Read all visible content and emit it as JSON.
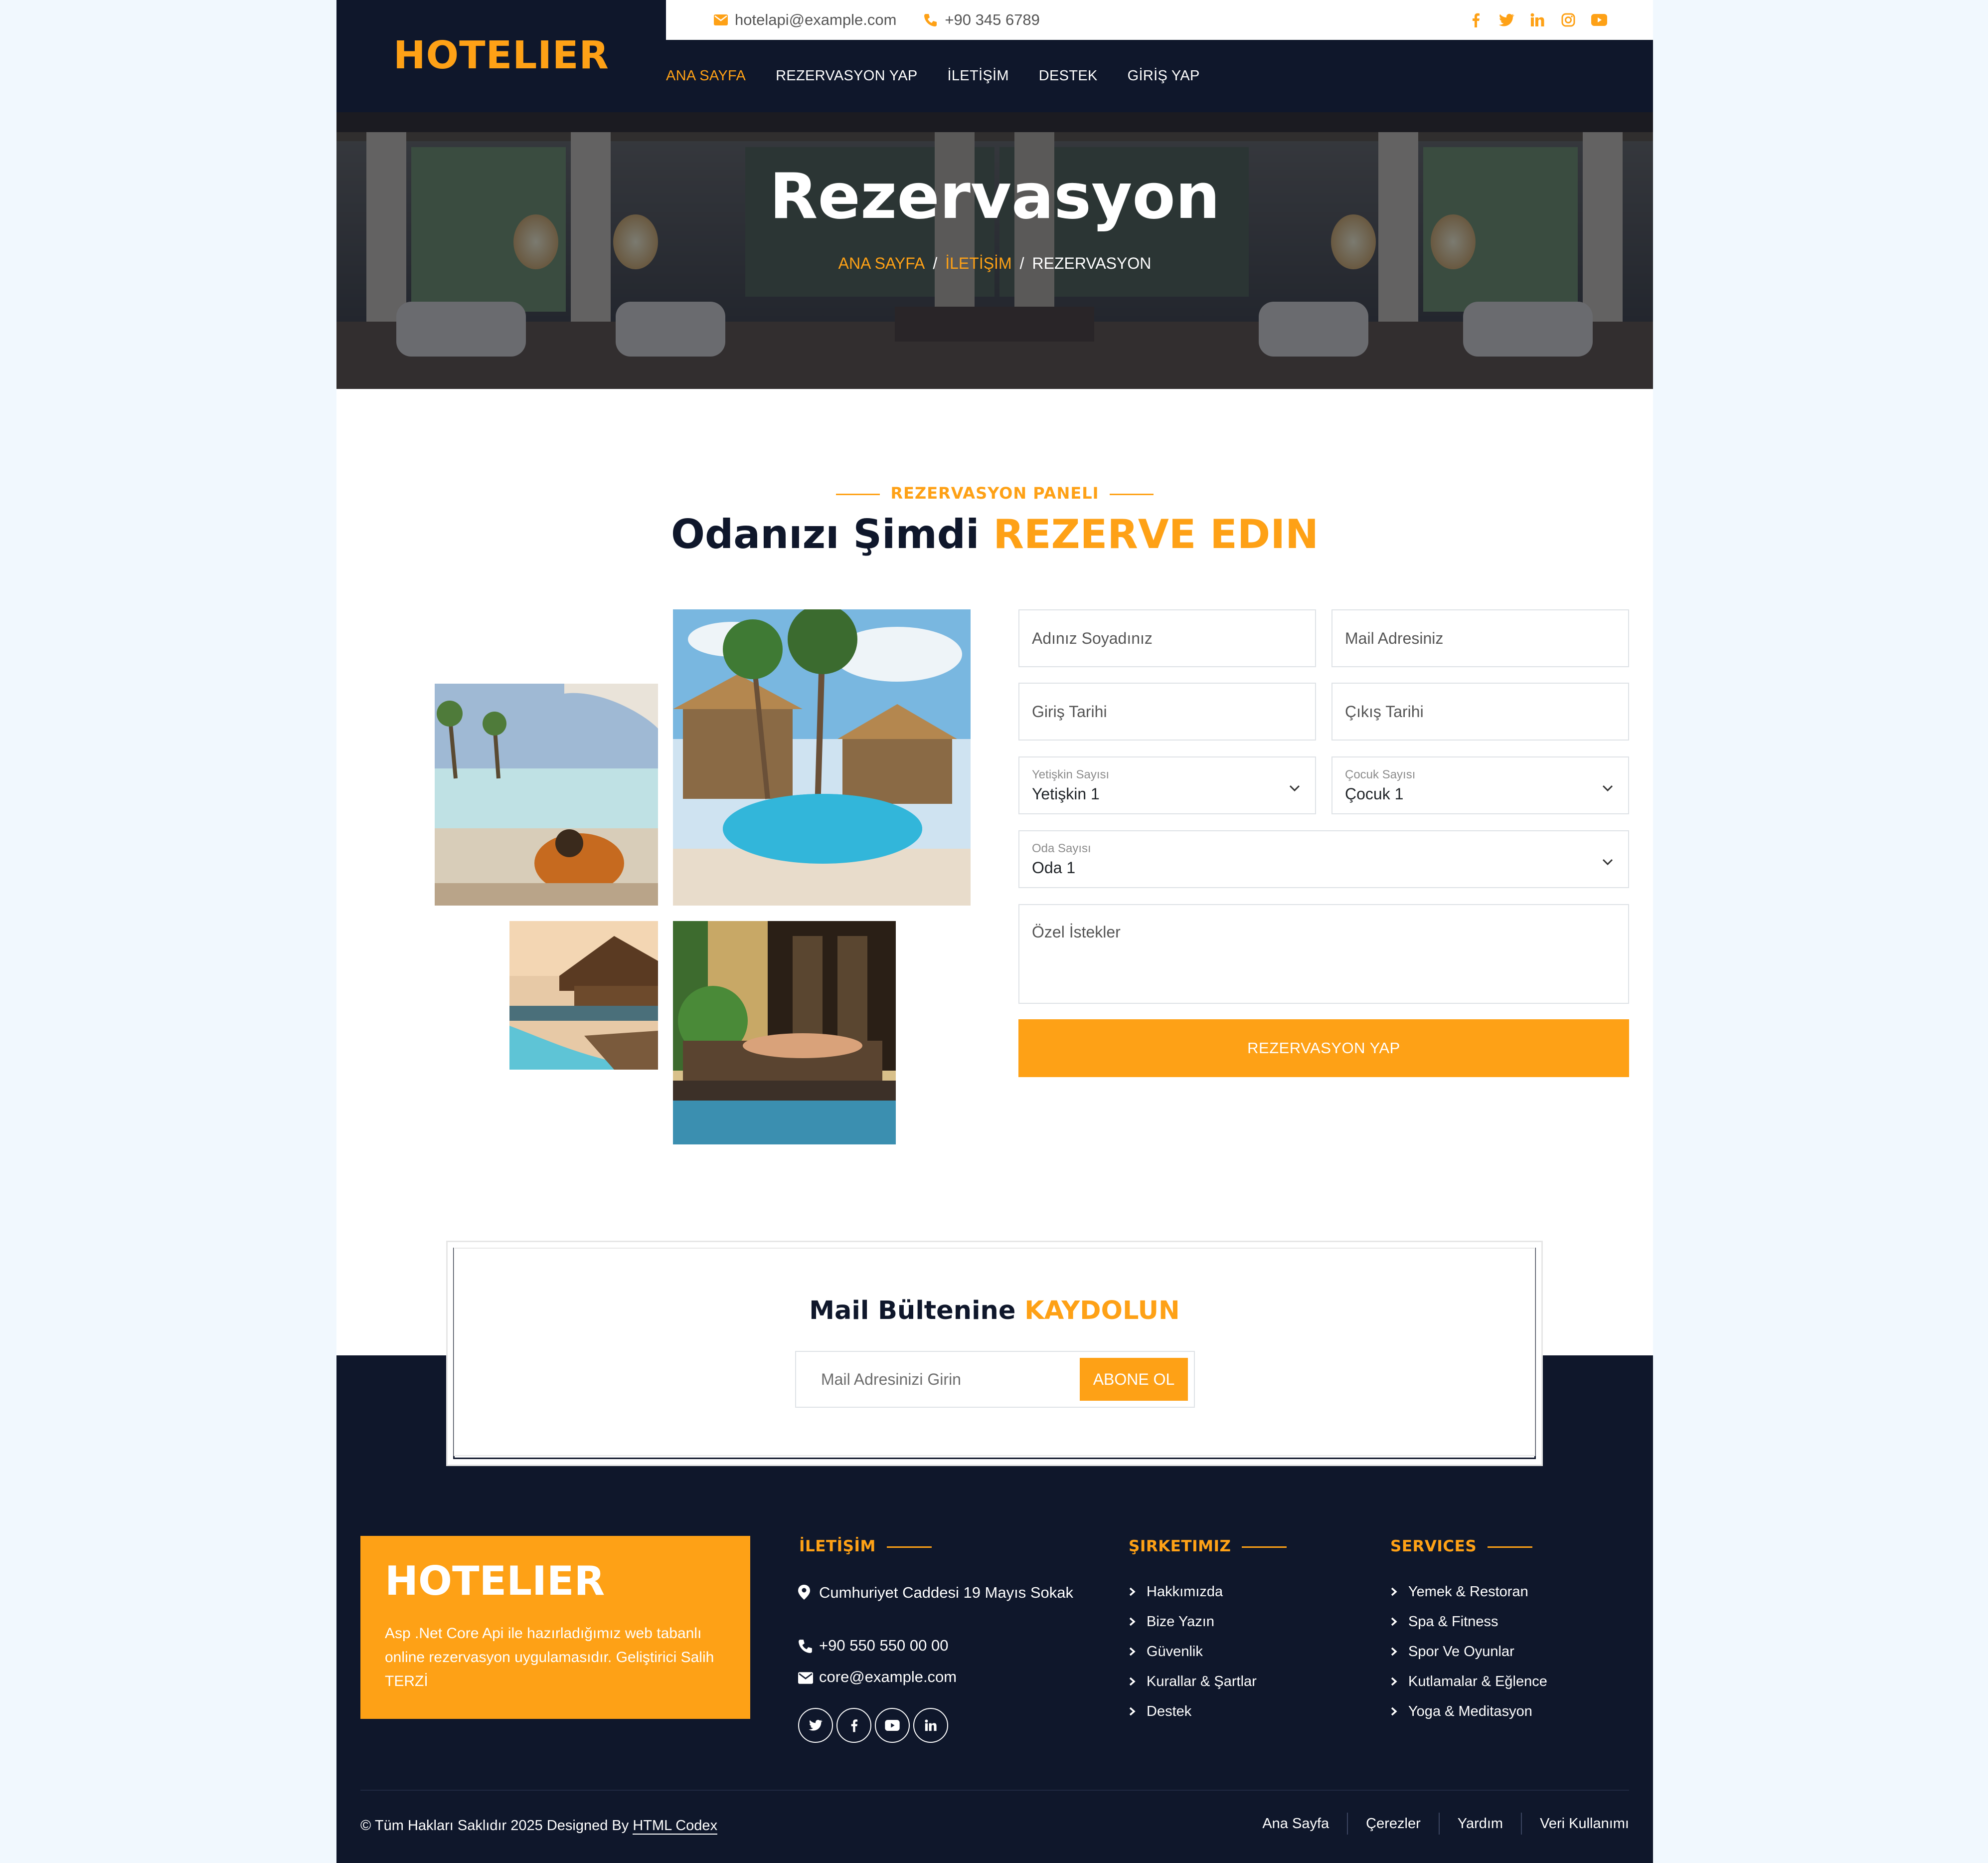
{
  "brand": {
    "name": "HOTELIER"
  },
  "topbar": {
    "email": "hotelapi@example.com",
    "phone": "+90 345 6789",
    "socials": [
      "facebook-icon",
      "twitter-icon",
      "linkedin-icon",
      "instagram-icon",
      "youtube-icon"
    ]
  },
  "nav": {
    "items": [
      {
        "label": "ANA SAYFA",
        "active": true
      },
      {
        "label": "REZERVASYON YAP"
      },
      {
        "label": "İLETİŞİM"
      },
      {
        "label": "DESTEK"
      },
      {
        "label": "GİRİŞ YAP"
      }
    ]
  },
  "hero": {
    "title": "Rezervasyon",
    "breadcrumb": [
      "ANA SAYFA",
      "İLETİŞİM",
      "REZERVASYON"
    ],
    "separator": "/"
  },
  "booking": {
    "subtitle": "REZERVASYON PANELI",
    "title_main": "Odanızı Şimdi",
    "title_accent": "REZERVE EDIN",
    "form": {
      "name_placeholder": "Adınız Soyadınız",
      "email_placeholder": "Mail Adresiniz",
      "checkin_placeholder": "Giriş Tarihi",
      "checkout_placeholder": "Çıkış Tarihi",
      "adults": {
        "label": "Yetişkin Sayısı",
        "value": "Yetişkin 1"
      },
      "children": {
        "label": "Çocuk Sayısı",
        "value": "Çocuk 1"
      },
      "rooms": {
        "label": "Oda Sayısı",
        "value": "Oda 1"
      },
      "requests_placeholder": "Özel İstekler",
      "submit_label": "REZERVASYON YAP"
    }
  },
  "newsletter": {
    "title_main": "Mail Bültenine",
    "title_accent": "KAYDOLUN",
    "placeholder": "Mail Adresinizi Girin",
    "button_label": "ABONE OL"
  },
  "footer": {
    "brand_name": "HOTELIER",
    "brand_description": "Asp .Net Core Api ile hazırladığımız web tabanlı online rezervasyon uygulamasıdır. Geliştirici Salih TERZİ",
    "contact": {
      "title": "İLETİŞİM",
      "address": "Cumhuriyet Caddesi 19 Mayıs Sokak",
      "phone": "+90 550 550 00 00",
      "email": "core@example.com",
      "socials": [
        "twitter-icon",
        "facebook-icon",
        "youtube-icon",
        "linkedin-icon"
      ]
    },
    "company": {
      "title": "ŞIRKETIMIZ",
      "items": [
        "Hakkımızda",
        "Bize Yazın",
        "Güvenlik",
        "Kurallar & Şartlar",
        "Destek"
      ]
    },
    "services": {
      "title": "SERVICES",
      "items": [
        "Yemek & Restoran",
        "Spa & Fitness",
        "Spor Ve Oyunlar",
        "Kutlamalar & Eğlence",
        "Yoga & Meditasyon"
      ]
    },
    "copyright_prefix": "© Tüm Hakları Saklıdır 2025 Designed By",
    "copyright_link": "HTML Codex",
    "menu": [
      "Ana Sayfa",
      "Çerezler",
      "Yardım",
      "Veri Kullanımı"
    ]
  },
  "colors": {
    "accent": "#fea116",
    "dark": "#0f172b"
  }
}
